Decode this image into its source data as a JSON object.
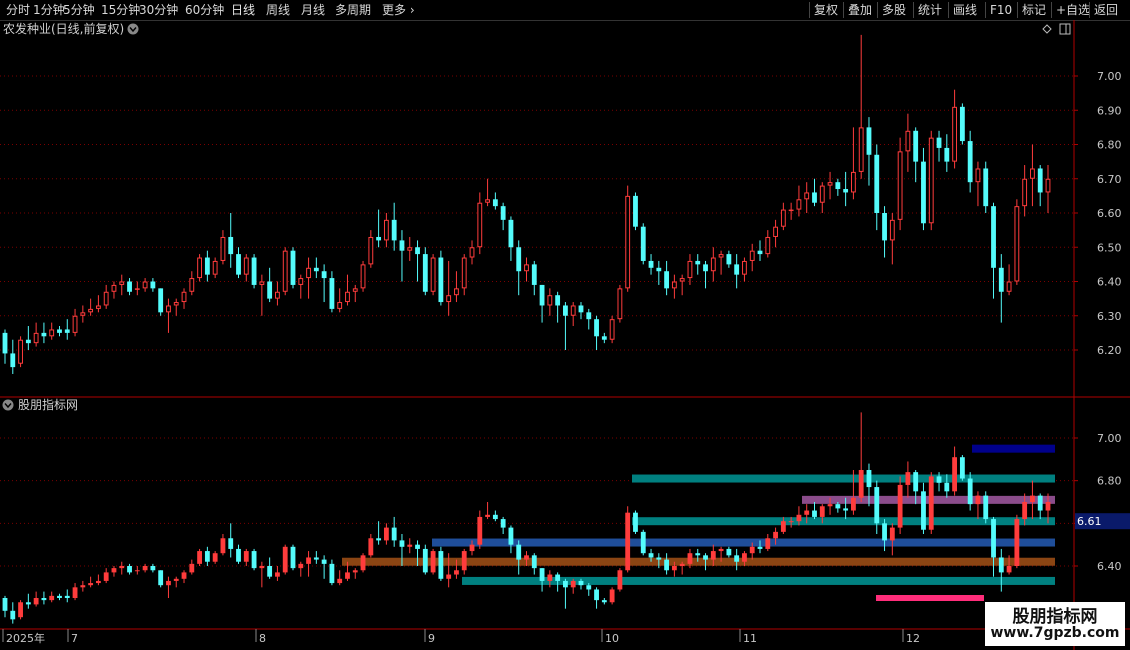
{
  "toolbar": {
    "left_items": [
      "分时",
      "1分钟",
      "5分钟",
      "15分钟",
      "30分钟",
      "60分钟",
      "日线",
      "周线",
      "月线",
      "多周期",
      "更多"
    ],
    "active": "日线",
    "right_items": [
      "复权",
      "叠加",
      "多股",
      "统计",
      "画线",
      "F10",
      "标记",
      "+自选",
      "返回"
    ]
  },
  "main_panel": {
    "title": "农发种业(日线,前复权)",
    "axis_ticks": [
      "7.00",
      "6.90",
      "6.80",
      "6.70",
      "6.60",
      "6.50",
      "6.40",
      "6.30",
      "6.20"
    ]
  },
  "indicator_panel": {
    "title": "股朋指标网",
    "axis_ticks": [
      "7.00",
      "6.80",
      "6.60",
      "6.40"
    ],
    "current_value_label": "6.61"
  },
  "x_axis": {
    "labels": [
      "2025年",
      "7",
      "8",
      "9",
      "10",
      "11",
      "12"
    ]
  },
  "colors": {
    "up": "#ff3c3c",
    "down": "#54fcfc",
    "axis": "#b00000",
    "grid": "#7a0000",
    "bands": [
      "#00008b",
      "#008080",
      "#8b4c8b",
      "#008080",
      "#1f4e9a",
      "#8b4513",
      "#008080",
      "#ff2d7a"
    ]
  },
  "chart_data": {
    "type": "candlestick",
    "title": "农发种业(日线,前复权)",
    "x_labels": [
      "2025年",
      "7",
      "8",
      "9",
      "10",
      "11",
      "12"
    ],
    "ylim": [
      6.12,
      7.12
    ],
    "indicator_ylim": [
      6.27,
      7.13
    ],
    "series": [
      {
        "name": "农发种业(日线,前复权)",
        "ohlc": [
          [
            6.25,
            6.26,
            6.16,
            6.19
          ],
          [
            6.19,
            6.23,
            6.13,
            6.15
          ],
          [
            6.16,
            6.24,
            6.15,
            6.23
          ],
          [
            6.23,
            6.27,
            6.2,
            6.22
          ],
          [
            6.22,
            6.28,
            6.21,
            6.25
          ],
          [
            6.25,
            6.28,
            6.22,
            6.24
          ],
          [
            6.24,
            6.28,
            6.23,
            6.26
          ],
          [
            6.26,
            6.27,
            6.24,
            6.25
          ],
          [
            6.26,
            6.29,
            6.23,
            6.25
          ],
          [
            6.25,
            6.32,
            6.24,
            6.3
          ],
          [
            6.3,
            6.33,
            6.28,
            6.31
          ],
          [
            6.31,
            6.35,
            6.3,
            6.32
          ],
          [
            6.32,
            6.36,
            6.31,
            6.33
          ],
          [
            6.33,
            6.39,
            6.32,
            6.37
          ],
          [
            6.37,
            6.4,
            6.35,
            6.39
          ],
          [
            6.39,
            6.42,
            6.36,
            6.4
          ],
          [
            6.4,
            6.41,
            6.36,
            6.37
          ],
          [
            6.38,
            6.4,
            6.36,
            6.38
          ],
          [
            6.38,
            6.41,
            6.37,
            6.4
          ],
          [
            6.4,
            6.41,
            6.37,
            6.38
          ],
          [
            6.38,
            6.38,
            6.3,
            6.31
          ],
          [
            6.31,
            6.35,
            6.25,
            6.33
          ],
          [
            6.33,
            6.35,
            6.3,
            6.34
          ],
          [
            6.34,
            6.38,
            6.32,
            6.37
          ],
          [
            6.37,
            6.43,
            6.36,
            6.41
          ],
          [
            6.41,
            6.48,
            6.4,
            6.47
          ],
          [
            6.47,
            6.49,
            6.4,
            6.42
          ],
          [
            6.42,
            6.47,
            6.41,
            6.46
          ],
          [
            6.46,
            6.55,
            6.45,
            6.53
          ],
          [
            6.53,
            6.6,
            6.44,
            6.48
          ],
          [
            6.48,
            6.5,
            6.41,
            6.42
          ],
          [
            6.42,
            6.48,
            6.4,
            6.47
          ],
          [
            6.47,
            6.48,
            6.38,
            6.39
          ],
          [
            6.39,
            6.42,
            6.3,
            6.4
          ],
          [
            6.4,
            6.44,
            6.34,
            6.35
          ],
          [
            6.35,
            6.4,
            6.33,
            6.37
          ],
          [
            6.37,
            6.5,
            6.36,
            6.49
          ],
          [
            6.49,
            6.5,
            6.38,
            6.39
          ],
          [
            6.39,
            6.42,
            6.35,
            6.41
          ],
          [
            6.41,
            6.47,
            6.35,
            6.44
          ],
          [
            6.44,
            6.47,
            6.41,
            6.43
          ],
          [
            6.43,
            6.45,
            6.34,
            6.41
          ],
          [
            6.41,
            6.43,
            6.31,
            6.32
          ],
          [
            6.32,
            6.38,
            6.31,
            6.34
          ],
          [
            6.34,
            6.42,
            6.33,
            6.37
          ],
          [
            6.37,
            6.39,
            6.34,
            6.38
          ],
          [
            6.38,
            6.46,
            6.37,
            6.45
          ],
          [
            6.45,
            6.55,
            6.44,
            6.53
          ],
          [
            6.53,
            6.61,
            6.5,
            6.52
          ],
          [
            6.52,
            6.6,
            6.5,
            6.58
          ],
          [
            6.58,
            6.63,
            6.49,
            6.52
          ],
          [
            6.52,
            6.55,
            6.4,
            6.49
          ],
          [
            6.49,
            6.53,
            6.46,
            6.5
          ],
          [
            6.5,
            6.52,
            6.4,
            6.48
          ],
          [
            6.48,
            6.5,
            6.36,
            6.37
          ],
          [
            6.37,
            6.48,
            6.36,
            6.47
          ],
          [
            6.47,
            6.49,
            6.33,
            6.34
          ],
          [
            6.34,
            6.46,
            6.3,
            6.36
          ],
          [
            6.36,
            6.43,
            6.34,
            6.38
          ],
          [
            6.38,
            6.48,
            6.36,
            6.47
          ],
          [
            6.47,
            6.52,
            6.45,
            6.5
          ],
          [
            6.5,
            6.66,
            6.48,
            6.63
          ],
          [
            6.63,
            6.7,
            6.62,
            6.64
          ],
          [
            6.64,
            6.66,
            6.61,
            6.62
          ],
          [
            6.62,
            6.63,
            6.55,
            6.58
          ],
          [
            6.58,
            6.59,
            6.46,
            6.5
          ],
          [
            6.5,
            6.52,
            6.36,
            6.43
          ],
          [
            6.43,
            6.47,
            6.4,
            6.45
          ],
          [
            6.45,
            6.46,
            6.36,
            6.39
          ],
          [
            6.39,
            6.39,
            6.28,
            6.33
          ],
          [
            6.33,
            6.38,
            6.3,
            6.36
          ],
          [
            6.36,
            6.37,
            6.28,
            6.33
          ],
          [
            6.33,
            6.34,
            6.2,
            6.3
          ],
          [
            6.3,
            6.34,
            6.27,
            6.33
          ],
          [
            6.33,
            6.34,
            6.29,
            6.31
          ],
          [
            6.31,
            6.32,
            6.26,
            6.29
          ],
          [
            6.29,
            6.3,
            6.2,
            6.24
          ],
          [
            6.24,
            6.25,
            6.22,
            6.23
          ],
          [
            6.23,
            6.3,
            6.22,
            6.29
          ],
          [
            6.29,
            6.39,
            6.28,
            6.38
          ],
          [
            6.38,
            6.68,
            6.37,
            6.65
          ],
          [
            6.65,
            6.66,
            6.55,
            6.56
          ],
          [
            6.56,
            6.57,
            6.45,
            6.46
          ],
          [
            6.46,
            6.48,
            6.42,
            6.44
          ],
          [
            6.44,
            6.46,
            6.39,
            6.43
          ],
          [
            6.43,
            6.46,
            6.36,
            6.38
          ],
          [
            6.38,
            6.42,
            6.35,
            6.4
          ],
          [
            6.4,
            6.42,
            6.36,
            6.41
          ],
          [
            6.41,
            6.48,
            6.39,
            6.46
          ],
          [
            6.46,
            6.48,
            6.42,
            6.45
          ],
          [
            6.45,
            6.46,
            6.38,
            6.43
          ],
          [
            6.43,
            6.5,
            6.4,
            6.47
          ],
          [
            6.47,
            6.49,
            6.42,
            6.48
          ],
          [
            6.48,
            6.49,
            6.44,
            6.45
          ],
          [
            6.45,
            6.48,
            6.38,
            6.42
          ],
          [
            6.42,
            6.47,
            6.4,
            6.46
          ],
          [
            6.46,
            6.51,
            6.43,
            6.49
          ],
          [
            6.49,
            6.52,
            6.46,
            6.48
          ],
          [
            6.48,
            6.55,
            6.47,
            6.53
          ],
          [
            6.53,
            6.58,
            6.5,
            6.56
          ],
          [
            6.56,
            6.63,
            6.55,
            6.61
          ],
          [
            6.61,
            6.63,
            6.58,
            6.61
          ],
          [
            6.61,
            6.68,
            6.59,
            6.64
          ],
          [
            6.64,
            6.69,
            6.6,
            6.66
          ],
          [
            6.66,
            6.7,
            6.62,
            6.63
          ],
          [
            6.63,
            6.69,
            6.6,
            6.68
          ],
          [
            6.68,
            6.72,
            6.64,
            6.69
          ],
          [
            6.69,
            6.7,
            6.65,
            6.67
          ],
          [
            6.67,
            6.72,
            6.62,
            6.66
          ],
          [
            6.66,
            6.85,
            6.64,
            6.72
          ],
          [
            6.72,
            7.12,
            6.7,
            6.85
          ],
          [
            6.85,
            6.88,
            6.68,
            6.77
          ],
          [
            6.77,
            6.8,
            6.55,
            6.6
          ],
          [
            6.6,
            6.62,
            6.47,
            6.52
          ],
          [
            6.52,
            6.6,
            6.45,
            6.58
          ],
          [
            6.58,
            6.82,
            6.55,
            6.78
          ],
          [
            6.78,
            6.89,
            6.72,
            6.84
          ],
          [
            6.84,
            6.85,
            6.69,
            6.75
          ],
          [
            6.75,
            6.79,
            6.55,
            6.57
          ],
          [
            6.57,
            6.84,
            6.55,
            6.82
          ],
          [
            6.82,
            6.84,
            6.75,
            6.79
          ],
          [
            6.79,
            6.83,
            6.72,
            6.75
          ],
          [
            6.75,
            6.96,
            6.73,
            6.91
          ],
          [
            6.91,
            6.92,
            6.8,
            6.81
          ],
          [
            6.81,
            6.84,
            6.66,
            6.69
          ],
          [
            6.69,
            6.75,
            6.62,
            6.73
          ],
          [
            6.73,
            6.75,
            6.6,
            6.62
          ],
          [
            6.62,
            6.63,
            6.35,
            6.44
          ],
          [
            6.44,
            6.48,
            6.28,
            6.37
          ],
          [
            6.37,
            6.45,
            6.36,
            6.4
          ],
          [
            6.4,
            6.64,
            6.39,
            6.62
          ],
          [
            6.62,
            6.74,
            6.59,
            6.7
          ],
          [
            6.7,
            6.8,
            6.62,
            6.73
          ],
          [
            6.73,
            6.74,
            6.62,
            6.66
          ],
          [
            6.66,
            6.74,
            6.6,
            6.7
          ]
        ]
      }
    ],
    "indicator_levels": [
      {
        "value": 6.95,
        "color": "#00008b"
      },
      {
        "value": 6.81,
        "color": "#008080"
      },
      {
        "value": 6.71,
        "color": "#8b4c8b"
      },
      {
        "value": 6.61,
        "color": "#008080"
      },
      {
        "value": 6.51,
        "color": "#1f4e9a"
      },
      {
        "value": 6.42,
        "color": "#8b4513"
      },
      {
        "value": 6.33,
        "color": "#008080"
      },
      {
        "value": 6.25,
        "color": "#ff2d7a"
      }
    ]
  },
  "watermark": {
    "title": "股朋指标网",
    "url": "www.7gpzb.com"
  }
}
